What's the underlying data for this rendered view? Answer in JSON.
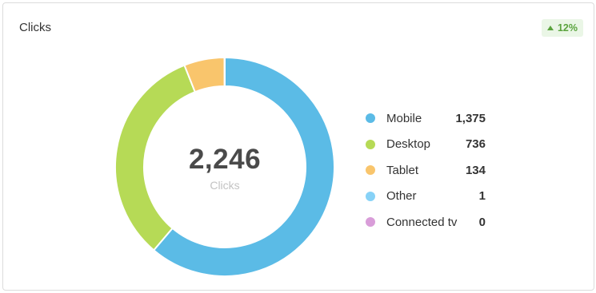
{
  "card": {
    "title": "Clicks",
    "trend_label": "12%",
    "trend_direction": "up",
    "trend_color": "#5aa33d"
  },
  "chart_data": {
    "type": "pie",
    "style": "donut",
    "total": "2,246",
    "center_label": "Clicks",
    "series": [
      {
        "name": "Mobile",
        "value": 1375,
        "value_label": "1,375",
        "color": "#5bbbe6"
      },
      {
        "name": "Desktop",
        "value": 736,
        "value_label": "736",
        "color": "#b6da56"
      },
      {
        "name": "Tablet",
        "value": 134,
        "value_label": "134",
        "color": "#f9c56c"
      },
      {
        "name": "Other",
        "value": 1,
        "value_label": "1",
        "color": "#87d2f7"
      },
      {
        "name": "Connected tv",
        "value": 0,
        "value_label": "0",
        "color": "#d99dd9"
      }
    ]
  }
}
